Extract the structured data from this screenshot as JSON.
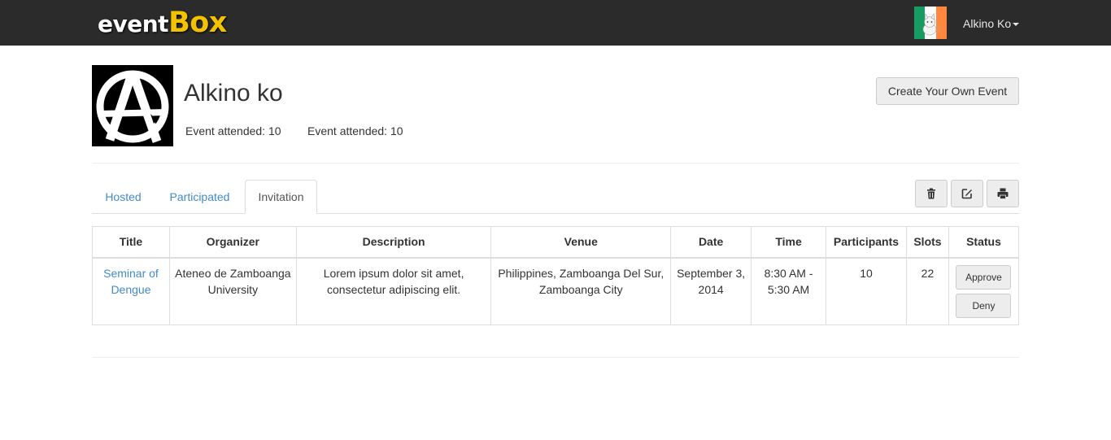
{
  "navbar": {
    "brand_event": "event",
    "brand_box": "Box",
    "user_name": "Alkino Ko",
    "avatar_colors": [
      "#169b62",
      "#ffffff",
      "#ff883e"
    ]
  },
  "profile": {
    "name": "Alkino ko",
    "stat_1": "Event attended: 10",
    "stat_2": "Event attended: 10",
    "create_button": "Create Your Own Event"
  },
  "tabs": [
    {
      "label": "Hosted"
    },
    {
      "label": "Participated"
    },
    {
      "label": "Invitation"
    }
  ],
  "active_tab": "Invitation",
  "toolbar": {
    "icons": [
      "trash-icon",
      "edit-icon",
      "print-icon"
    ]
  },
  "table": {
    "headers": [
      "Title",
      "Organizer",
      "Description",
      "Venue",
      "Date",
      "Time",
      "Participants",
      "Slots",
      "Status"
    ],
    "rows": [
      {
        "title": "Seminar of Dengue",
        "organizer": "Ateneo de Zamboanga University",
        "description": "Lorem ipsum dolor sit amet, consectetur adipiscing elit.",
        "venue": "Philippines, Zamboanga Del Sur, Zamboanga City",
        "date": "September 3, 2014",
        "time": "8:30 AM - 5:30 AM",
        "participants": "10",
        "slots": "22",
        "approve_label": "Approve",
        "deny_label": "Deny"
      }
    ]
  },
  "colors": {
    "navbar_bg": "#2b2b2b",
    "brand_accent": "#f2c200",
    "link": "#428bca"
  }
}
